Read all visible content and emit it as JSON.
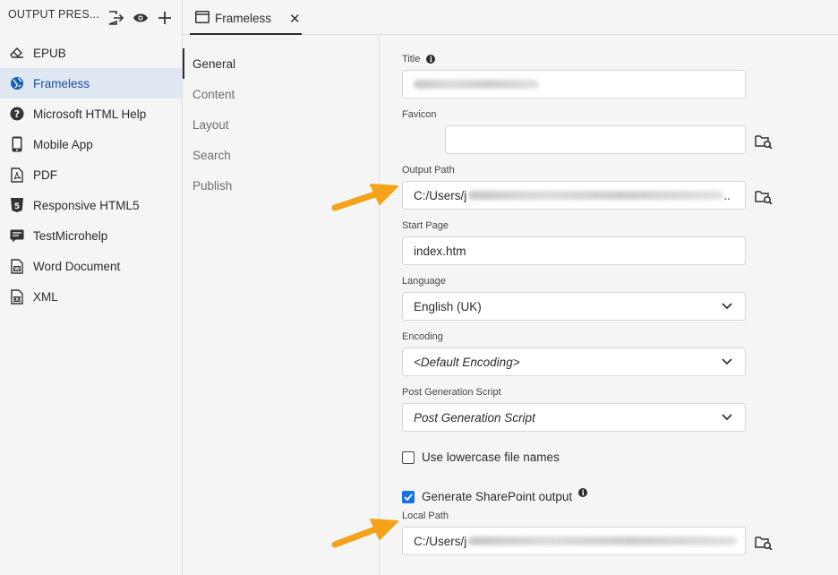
{
  "left_panel": {
    "title": "OUTPUT PRES...",
    "presets": [
      {
        "label": "EPUB",
        "icon": "eraser-icon"
      },
      {
        "label": "Frameless",
        "icon": "globe-icon"
      },
      {
        "label": "Microsoft HTML Help",
        "icon": "help-circle-icon"
      },
      {
        "label": "Mobile App",
        "icon": "mobile-phone-icon"
      },
      {
        "label": "PDF",
        "icon": "pdf-file-icon"
      },
      {
        "label": "Responsive HTML5",
        "icon": "html5-icon"
      },
      {
        "label": "TestMicrohelp",
        "icon": "microhelp-icon"
      },
      {
        "label": "Word Document",
        "icon": "word-doc-icon"
      },
      {
        "label": "XML",
        "icon": "xml-file-icon"
      }
    ],
    "selected": "Frameless"
  },
  "tab": {
    "label": "Frameless",
    "close": "✕"
  },
  "nav": {
    "items": [
      "General",
      "Content",
      "Layout",
      "Search",
      "Publish"
    ],
    "active": "General"
  },
  "form": {
    "title_label": "Title",
    "title_value": "",
    "favicon_label": "Favicon",
    "favicon_value": "",
    "output_path_label": "Output Path",
    "output_path_value": "C:/Users/j",
    "output_path_suffix": "..",
    "start_page_label": "Start Page",
    "start_page_value": "index.htm",
    "language_label": "Language",
    "language_value": "English (UK)",
    "encoding_label": "Encoding",
    "encoding_value": "<Default Encoding>",
    "post_script_label": "Post Generation Script",
    "post_script_value": "Post Generation Script",
    "lowercase_label": "Use lowercase file names",
    "lowercase_checked": false,
    "sharepoint_label": "Generate SharePoint output",
    "sharepoint_checked": true,
    "local_path_label": "Local Path",
    "local_path_value": "C:/Users/j"
  },
  "colors": {
    "accent": "#1473e6",
    "arrow": "#f5a21b",
    "selected_bg": "#dfe7f3"
  }
}
